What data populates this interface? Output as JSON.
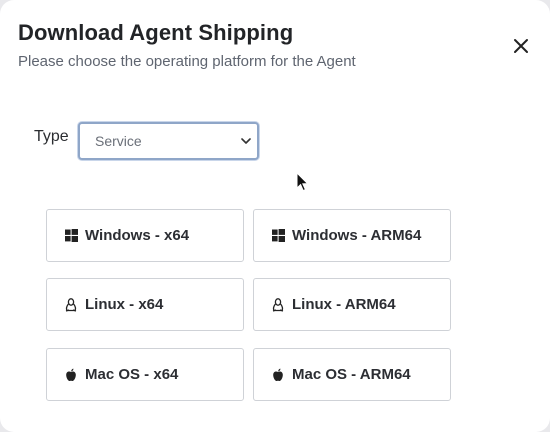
{
  "dialog": {
    "title": "Download Agent Shipping",
    "subtitle": "Please choose the operating platform for the Agent"
  },
  "type_field": {
    "label": "Type",
    "selected": "Service"
  },
  "buttons": [
    {
      "label": "Windows - x64",
      "icon": "windows-icon"
    },
    {
      "label": "Windows - ARM64",
      "icon": "windows-icon"
    },
    {
      "label": "Linux - x64",
      "icon": "linux-icon"
    },
    {
      "label": "Linux - ARM64",
      "icon": "linux-icon"
    },
    {
      "label": "Mac OS - x64",
      "icon": "apple-icon"
    },
    {
      "label": "Mac OS - ARM64",
      "icon": "apple-icon"
    }
  ]
}
